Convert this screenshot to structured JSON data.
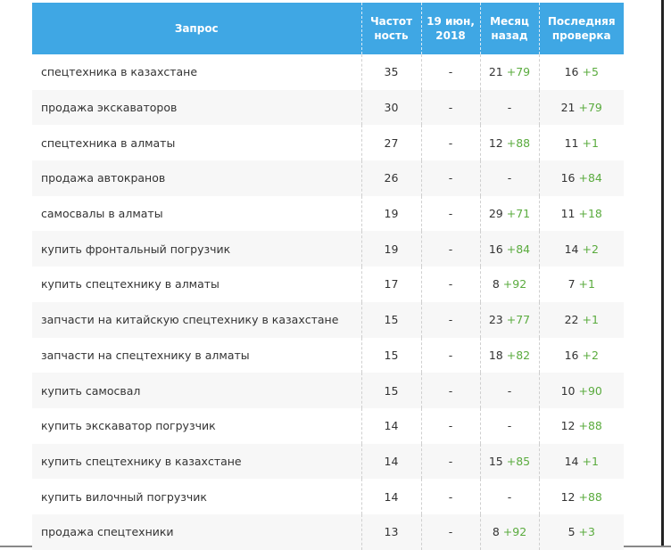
{
  "headers": {
    "query": "Запрос",
    "frequency": "Частот ность",
    "date": "19 июн, 2018",
    "month_ago": "Месяц назад",
    "last_check": "Последняя проверка"
  },
  "rows": [
    {
      "query": "спецтехника в казахстане",
      "freq": "35",
      "date": "-",
      "month": "21",
      "month_delta": "+79",
      "last": "16",
      "last_delta": "+5"
    },
    {
      "query": "продажа экскаваторов",
      "freq": "30",
      "date": "-",
      "month": "-",
      "month_delta": "",
      "last": "21",
      "last_delta": "+79"
    },
    {
      "query": "спецтехника в алматы",
      "freq": "27",
      "date": "-",
      "month": "12",
      "month_delta": "+88",
      "last": "11",
      "last_delta": "+1"
    },
    {
      "query": "продажа автокранов",
      "freq": "26",
      "date": "-",
      "month": "-",
      "month_delta": "",
      "last": "16",
      "last_delta": "+84"
    },
    {
      "query": "самосвалы в алматы",
      "freq": "19",
      "date": "-",
      "month": "29",
      "month_delta": "+71",
      "last": "11",
      "last_delta": "+18"
    },
    {
      "query": "купить фронтальный погрузчик",
      "freq": "19",
      "date": "-",
      "month": "16",
      "month_delta": "+84",
      "last": "14",
      "last_delta": "+2"
    },
    {
      "query": "купить спецтехнику в алматы",
      "freq": "17",
      "date": "-",
      "month": "8",
      "month_delta": "+92",
      "last": "7",
      "last_delta": "+1"
    },
    {
      "query": "запчасти на китайскую спецтехнику в казахстане",
      "freq": "15",
      "date": "-",
      "month": "23",
      "month_delta": "+77",
      "last": "22",
      "last_delta": "+1"
    },
    {
      "query": "запчасти на спецтехнику в алматы",
      "freq": "15",
      "date": "-",
      "month": "18",
      "month_delta": "+82",
      "last": "16",
      "last_delta": "+2"
    },
    {
      "query": "купить самосвал",
      "freq": "15",
      "date": "-",
      "month": "-",
      "month_delta": "",
      "last": "10",
      "last_delta": "+90"
    },
    {
      "query": "купить экскаватор погрузчик",
      "freq": "14",
      "date": "-",
      "month": "-",
      "month_delta": "",
      "last": "12",
      "last_delta": "+88"
    },
    {
      "query": "купить спецтехнику в казахстане",
      "freq": "14",
      "date": "-",
      "month": "15",
      "month_delta": "+85",
      "last": "14",
      "last_delta": "+1"
    },
    {
      "query": "купить вилочный погрузчик",
      "freq": "14",
      "date": "-",
      "month": "-",
      "month_delta": "",
      "last": "12",
      "last_delta": "+88"
    },
    {
      "query": "продажа спецтехники",
      "freq": "13",
      "date": "-",
      "month": "8",
      "month_delta": "+92",
      "last": "5",
      "last_delta": "+3"
    }
  ],
  "colors": {
    "header_bg": "#3fa7e4",
    "delta_green": "#5aab3e"
  }
}
